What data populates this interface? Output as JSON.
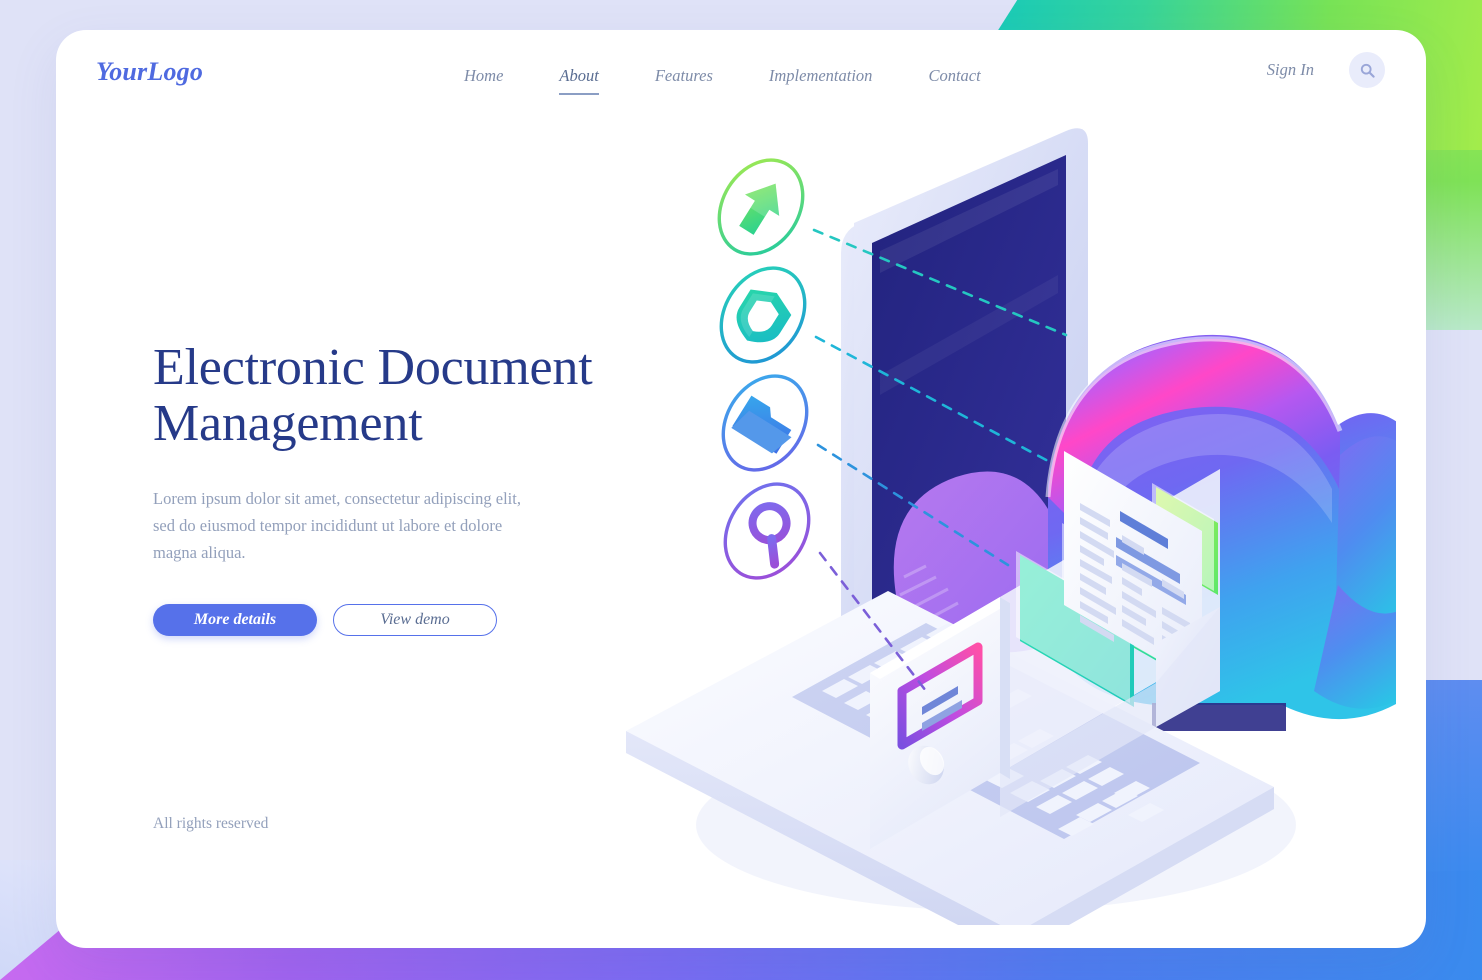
{
  "page": {
    "background_color": "#dfe2f7",
    "card_background": "#ffffff"
  },
  "header": {
    "logo": "YourLogo",
    "nav": [
      {
        "label": "Home",
        "active": false
      },
      {
        "label": "About",
        "active": true
      },
      {
        "label": "Features",
        "active": false
      },
      {
        "label": "Implementation",
        "active": false
      },
      {
        "label": "Contact",
        "active": false
      }
    ],
    "signin_label": "Sign In",
    "search_icon": "search-icon"
  },
  "hero": {
    "title": "Electronic Document Management",
    "subtitle": "Lorem ipsum dolor sit amet, consectetur adipiscing elit, sed do eiusmod tempor incididunt ut labore et dolore magna aliqua.",
    "primary_button": "More details",
    "secondary_button": "View demo",
    "title_color": "#263a89",
    "accent_color": "#5671ea"
  },
  "footer": {
    "copyright": "All rights reserved"
  },
  "illustration": {
    "name": "isometric-document-management-illustration",
    "feature_icons": [
      {
        "name": "upload-arrow-icon",
        "color": "#3ad07e"
      },
      {
        "name": "shield-icon",
        "color": "#22c6b4"
      },
      {
        "name": "folder-icon",
        "color": "#2f8ae8"
      },
      {
        "name": "magnifier-icon",
        "color": "#8558e0"
      }
    ],
    "objects": [
      "laptop",
      "laptop-screen",
      "keyboard",
      "cloud",
      "file-drawer",
      "document-sheet",
      "colored-folders"
    ],
    "cloud_gradient": [
      "#ff4fd0",
      "#9a5bf0",
      "#3aa7f0"
    ],
    "screen_color": "#2a2a8f"
  },
  "decor": {
    "top_right_gradient": [
      "#0bc6c6",
      "#a3ec4b"
    ],
    "bottom_gradient": [
      "#c86bf0",
      "#3a8bee"
    ]
  }
}
